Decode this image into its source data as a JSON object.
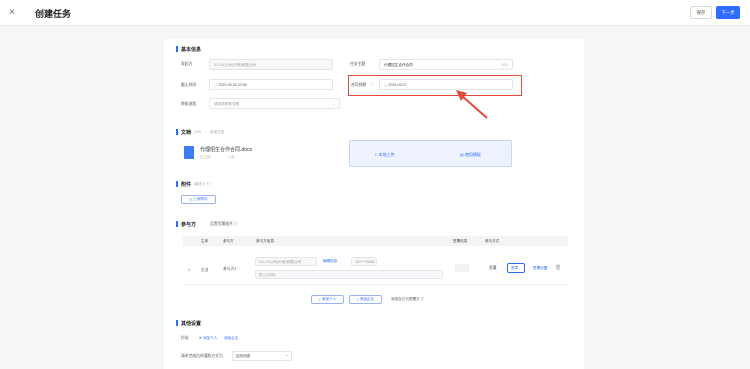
{
  "header": {
    "close_icon": "×",
    "title": "创建任务",
    "save_label": "保存",
    "next_label": "下一步"
  },
  "basic": {
    "section_title": "基本信息",
    "initiator_label": "发起方",
    "initiator_value": "XX-XX公司(示例)有限公司",
    "subject_label": "任务主题",
    "subject_value": "代理招生合作合同",
    "subject_count": "8/50",
    "deadline_label": "截止时间",
    "deadline_value": "2023-09-30 23:59",
    "contract_end_label": "合同到期",
    "contract_end_value": "2024-09-27",
    "process_label": "审批流程",
    "process_value": "请选择审批流程"
  },
  "documents": {
    "section_title": "文档",
    "hint": "(1/5)",
    "add_link": "新增文档",
    "file_name": "代理招生合作合同.docx",
    "file_meta1": "已上传",
    "file_meta2": "1 页",
    "upload_local": "本地上传",
    "use_template": "使用模板"
  },
  "attachments": {
    "section_title": "附件",
    "hint": "(最多 5 个)",
    "upload_label": "上传附件"
  },
  "participants": {
    "section_title": "参与方",
    "setting_link": "设置签署顺序",
    "columns": [
      "主体",
      "参与方",
      "参与方信息",
      "签署信息",
      "参与方式"
    ],
    "row": {
      "index": "1",
      "type": "企业",
      "role": "参与方1",
      "company": "XX-XX公司(示例)有限公司",
      "edit_link": "编辑信息",
      "contact": "张三(示例)",
      "phone": "187****8888",
      "sign_mode": "签署",
      "sign_tag": "签章",
      "setting": "签署设置"
    },
    "add_person": "添加个人",
    "add_company": "添加企业",
    "add_self": "添加自己为签署方"
  },
  "other": {
    "section_title": "其他设置",
    "cc_label": "抄送",
    "add_cc": "添加个人",
    "add_org": "添加企业",
    "notify_label": "请求完成后的通知方式为",
    "notify_value": "站内消息"
  }
}
